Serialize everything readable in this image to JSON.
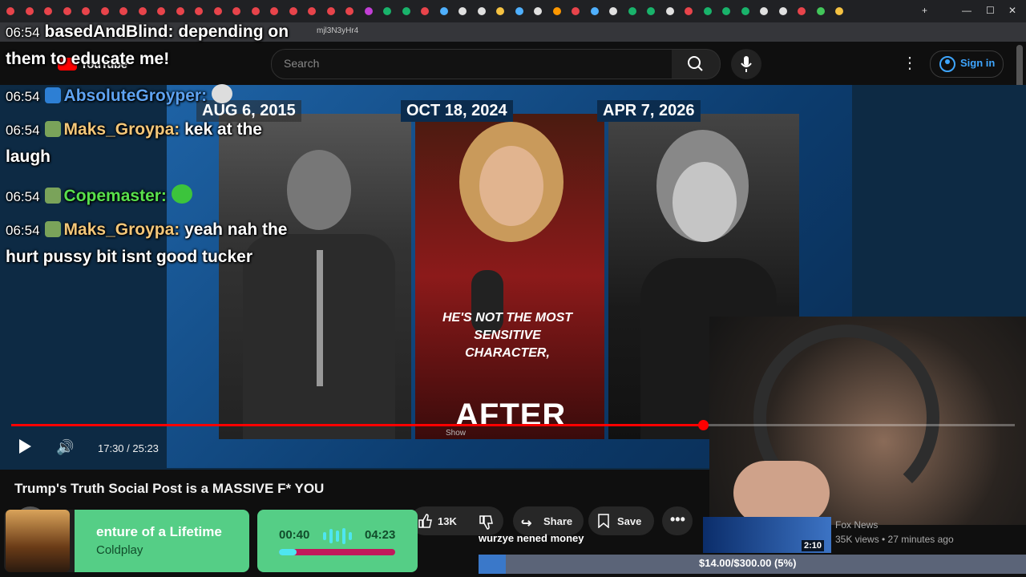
{
  "browser": {
    "url": "mjl3N3yHr4",
    "tab_colors": [
      "#e8444b",
      "#e8444b",
      "#e8444b",
      "#e8444b",
      "#e8444b",
      "#e8444b",
      "#e8444b",
      "#e8444b",
      "#e8444b",
      "#e8444b",
      "#e8444b",
      "#e8444b",
      "#e8444b",
      "#e8444b",
      "#e8444b",
      "#e8444b",
      "#e8444b",
      "#e8444b",
      "#e8444b",
      "#c23fd6",
      "#19b36b",
      "#19b36b",
      "#e8444b",
      "#4fb0ff",
      "#e0e0e0",
      "#e0e0e0",
      "#f5c242",
      "#4fb0ff",
      "#e0e0e0",
      "#ff9800",
      "#e8444b",
      "#4fb0ff",
      "#e0e0e0",
      "#19b36b",
      "#19b36b",
      "#e0e0e0",
      "#e8444b",
      "#19b36b",
      "#19b36b",
      "#19b36b",
      "#e0e0e0",
      "#e0e0e0",
      "#e8444b",
      "#42c65a",
      "#f5c242"
    ]
  },
  "youtube": {
    "logo": "YouTube",
    "search_placeholder": "Search",
    "sign_in": "Sign in"
  },
  "video": {
    "dates": [
      "AUG 6, 2015",
      "OCT 18, 2024",
      "APR 7, 2026"
    ],
    "caption": "HE'S NOT THE MOST SENSITIVE CHARACTER,",
    "big_text": "AFTER",
    "watermark": "Show",
    "current_time": "17:30",
    "duration": "25:23",
    "time_display": "17:30 / 25:23",
    "progress": 0.689
  },
  "below_video": {
    "title": "Trump's Truth Social Post is a MASSIVE F* YOU",
    "likes": "13K",
    "share": "Share",
    "save": "Save"
  },
  "chat": [
    {
      "time": "06:54",
      "user": "basedAndBlind:",
      "user_color": "#ffffff",
      "message": "depending on",
      "continuation": "them to educate me!"
    },
    {
      "time": "06:54",
      "user": "AbsoluteGroyper:",
      "user_color": "#5ea3f2",
      "message": "",
      "continuation": ""
    },
    {
      "time": "06:54",
      "user": "Maks_Groypa:",
      "user_color": "#f3c77a",
      "message": "kek at the",
      "continuation": "laugh"
    },
    {
      "time": "06:54",
      "user": "Copemaster:",
      "user_color": "#58e04d",
      "message": "",
      "continuation": ""
    },
    {
      "time": "06:54",
      "user": "Maks_Groypa:",
      "user_color": "#f3c77a",
      "message": "yeah nah the",
      "continuation": "hurt pussy bit isnt good tucker"
    }
  ],
  "music": {
    "song": "enture of a Lifetime",
    "artist": "Coldplay",
    "elapsed": "00:40",
    "total": "04:23",
    "progress": 0.15
  },
  "overlay": {
    "message_text": "wurzye nened money",
    "donation_text": "$14.00/$300.00 (5%)",
    "donation_progress": 0.05
  },
  "recommended": {
    "duration": "2:10",
    "channel": "Fox News",
    "meta": "35K views • 27 minutes ago"
  }
}
